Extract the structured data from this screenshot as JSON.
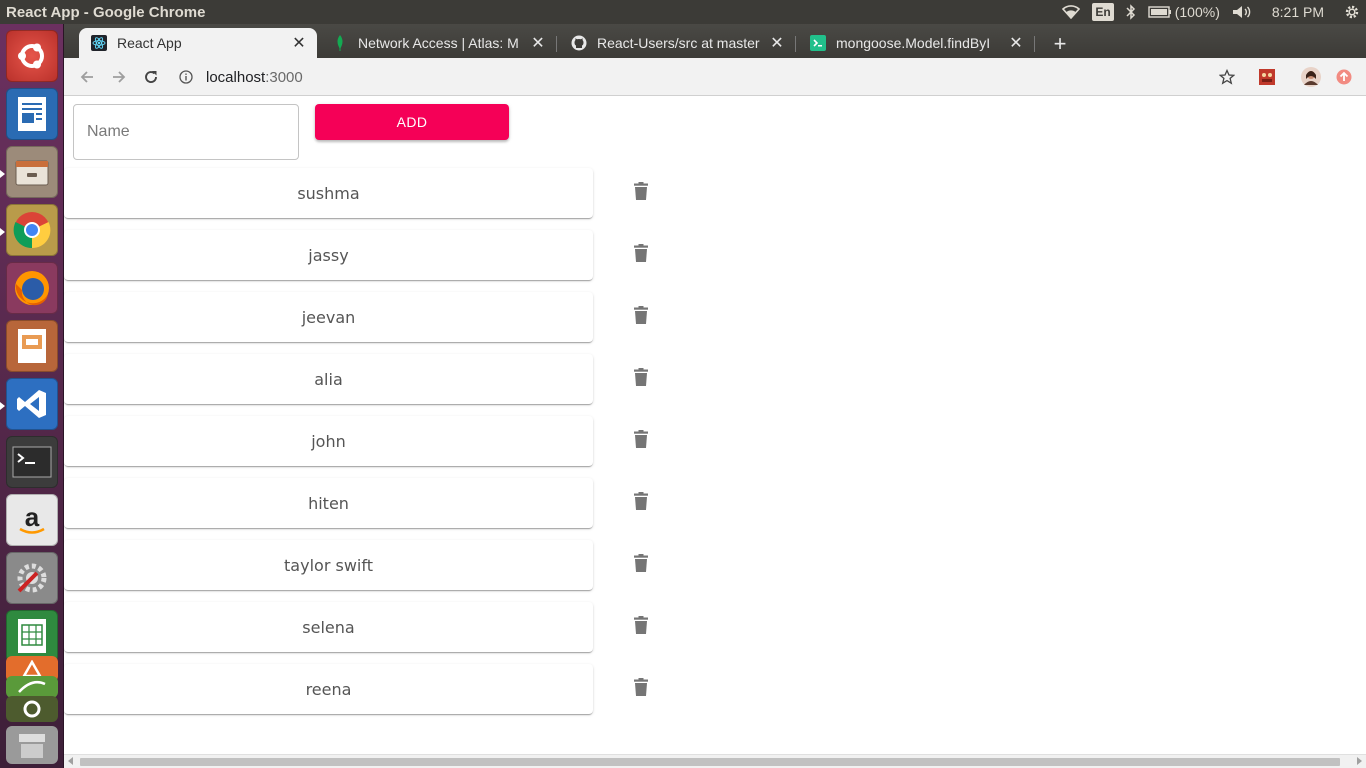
{
  "window": {
    "title": "React App - Google Chrome"
  },
  "system_tray": {
    "language": "En",
    "battery": "(100%)",
    "time": "8:21 PM"
  },
  "tabs": [
    {
      "label": "React App",
      "favicon": "react-icon",
      "active": true
    },
    {
      "label": "Network Access | Atlas: M",
      "favicon": "mongodb-leaf-icon",
      "active": false
    },
    {
      "label": "React-Users/src at master",
      "favicon": "github-icon",
      "active": false
    },
    {
      "label": "mongoose.Model.findByI",
      "favicon": "terminal-green-icon",
      "active": false
    }
  ],
  "address_bar": {
    "host": "localhost",
    "port": ":3000"
  },
  "form": {
    "name_placeholder": "Name",
    "name_value": "",
    "add_label": "ADD"
  },
  "users": [
    "sushma",
    "jassy",
    "jeevan",
    "alia",
    "john",
    "hiten",
    "taylor swift",
    "selena",
    "reena"
  ],
  "colors": {
    "accent": "#f50057",
    "launcher": "#5e2750",
    "panel": "#3c3b37"
  },
  "launcher": [
    "ubuntu-dash-icon",
    "libreoffice-writer-icon",
    "files-icon",
    "chrome-icon",
    "firefox-icon",
    "libreoffice-impress-icon",
    "vscode-icon",
    "terminal-icon",
    "amazon-icon",
    "system-settings-icon",
    "libreoffice-calc-icon",
    "software-center-icon",
    "trash-icon"
  ]
}
